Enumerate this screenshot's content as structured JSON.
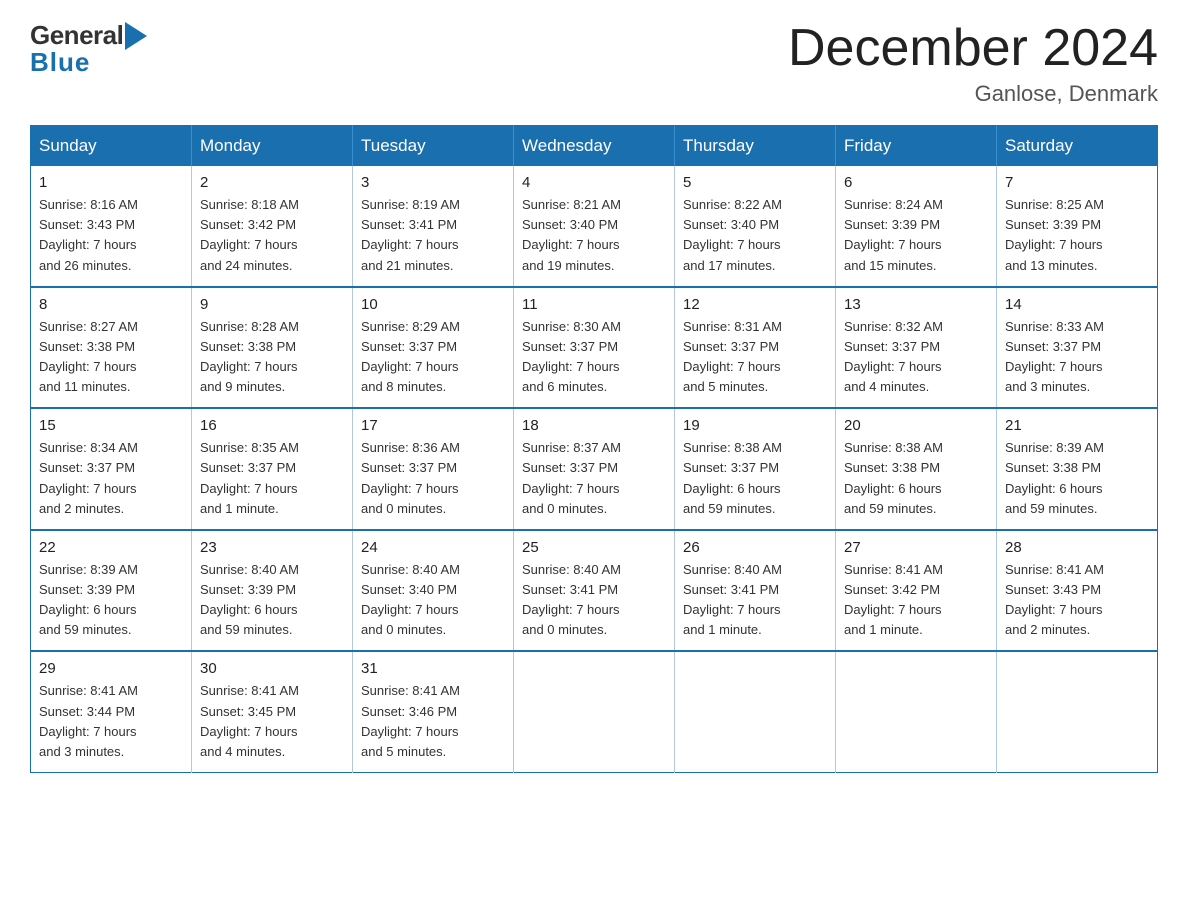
{
  "header": {
    "logo": {
      "general": "General",
      "blue": "Blue"
    },
    "title": "December 2024",
    "location": "Ganlose, Denmark"
  },
  "days_of_week": [
    "Sunday",
    "Monday",
    "Tuesday",
    "Wednesday",
    "Thursday",
    "Friday",
    "Saturday"
  ],
  "weeks": [
    [
      {
        "day": "1",
        "sunrise": "8:16 AM",
        "sunset": "3:43 PM",
        "daylight": "7 hours and 26 minutes."
      },
      {
        "day": "2",
        "sunrise": "8:18 AM",
        "sunset": "3:42 PM",
        "daylight": "7 hours and 24 minutes."
      },
      {
        "day": "3",
        "sunrise": "8:19 AM",
        "sunset": "3:41 PM",
        "daylight": "7 hours and 21 minutes."
      },
      {
        "day": "4",
        "sunrise": "8:21 AM",
        "sunset": "3:40 PM",
        "daylight": "7 hours and 19 minutes."
      },
      {
        "day": "5",
        "sunrise": "8:22 AM",
        "sunset": "3:40 PM",
        "daylight": "7 hours and 17 minutes."
      },
      {
        "day": "6",
        "sunrise": "8:24 AM",
        "sunset": "3:39 PM",
        "daylight": "7 hours and 15 minutes."
      },
      {
        "day": "7",
        "sunrise": "8:25 AM",
        "sunset": "3:39 PM",
        "daylight": "7 hours and 13 minutes."
      }
    ],
    [
      {
        "day": "8",
        "sunrise": "8:27 AM",
        "sunset": "3:38 PM",
        "daylight": "7 hours and 11 minutes."
      },
      {
        "day": "9",
        "sunrise": "8:28 AM",
        "sunset": "3:38 PM",
        "daylight": "7 hours and 9 minutes."
      },
      {
        "day": "10",
        "sunrise": "8:29 AM",
        "sunset": "3:37 PM",
        "daylight": "7 hours and 8 minutes."
      },
      {
        "day": "11",
        "sunrise": "8:30 AM",
        "sunset": "3:37 PM",
        "daylight": "7 hours and 6 minutes."
      },
      {
        "day": "12",
        "sunrise": "8:31 AM",
        "sunset": "3:37 PM",
        "daylight": "7 hours and 5 minutes."
      },
      {
        "day": "13",
        "sunrise": "8:32 AM",
        "sunset": "3:37 PM",
        "daylight": "7 hours and 4 minutes."
      },
      {
        "day": "14",
        "sunrise": "8:33 AM",
        "sunset": "3:37 PM",
        "daylight": "7 hours and 3 minutes."
      }
    ],
    [
      {
        "day": "15",
        "sunrise": "8:34 AM",
        "sunset": "3:37 PM",
        "daylight": "7 hours and 2 minutes."
      },
      {
        "day": "16",
        "sunrise": "8:35 AM",
        "sunset": "3:37 PM",
        "daylight": "7 hours and 1 minute."
      },
      {
        "day": "17",
        "sunrise": "8:36 AM",
        "sunset": "3:37 PM",
        "daylight": "7 hours and 0 minutes."
      },
      {
        "day": "18",
        "sunrise": "8:37 AM",
        "sunset": "3:37 PM",
        "daylight": "7 hours and 0 minutes."
      },
      {
        "day": "19",
        "sunrise": "8:38 AM",
        "sunset": "3:37 PM",
        "daylight": "6 hours and 59 minutes."
      },
      {
        "day": "20",
        "sunrise": "8:38 AM",
        "sunset": "3:38 PM",
        "daylight": "6 hours and 59 minutes."
      },
      {
        "day": "21",
        "sunrise": "8:39 AM",
        "sunset": "3:38 PM",
        "daylight": "6 hours and 59 minutes."
      }
    ],
    [
      {
        "day": "22",
        "sunrise": "8:39 AM",
        "sunset": "3:39 PM",
        "daylight": "6 hours and 59 minutes."
      },
      {
        "day": "23",
        "sunrise": "8:40 AM",
        "sunset": "3:39 PM",
        "daylight": "6 hours and 59 minutes."
      },
      {
        "day": "24",
        "sunrise": "8:40 AM",
        "sunset": "3:40 PM",
        "daylight": "7 hours and 0 minutes."
      },
      {
        "day": "25",
        "sunrise": "8:40 AM",
        "sunset": "3:41 PM",
        "daylight": "7 hours and 0 minutes."
      },
      {
        "day": "26",
        "sunrise": "8:40 AM",
        "sunset": "3:41 PM",
        "daylight": "7 hours and 1 minute."
      },
      {
        "day": "27",
        "sunrise": "8:41 AM",
        "sunset": "3:42 PM",
        "daylight": "7 hours and 1 minute."
      },
      {
        "day": "28",
        "sunrise": "8:41 AM",
        "sunset": "3:43 PM",
        "daylight": "7 hours and 2 minutes."
      }
    ],
    [
      {
        "day": "29",
        "sunrise": "8:41 AM",
        "sunset": "3:44 PM",
        "daylight": "7 hours and 3 minutes."
      },
      {
        "day": "30",
        "sunrise": "8:41 AM",
        "sunset": "3:45 PM",
        "daylight": "7 hours and 4 minutes."
      },
      {
        "day": "31",
        "sunrise": "8:41 AM",
        "sunset": "3:46 PM",
        "daylight": "7 hours and 5 minutes."
      },
      null,
      null,
      null,
      null
    ]
  ],
  "labels": {
    "sunrise": "Sunrise:",
    "sunset": "Sunset:",
    "daylight": "Daylight:"
  }
}
